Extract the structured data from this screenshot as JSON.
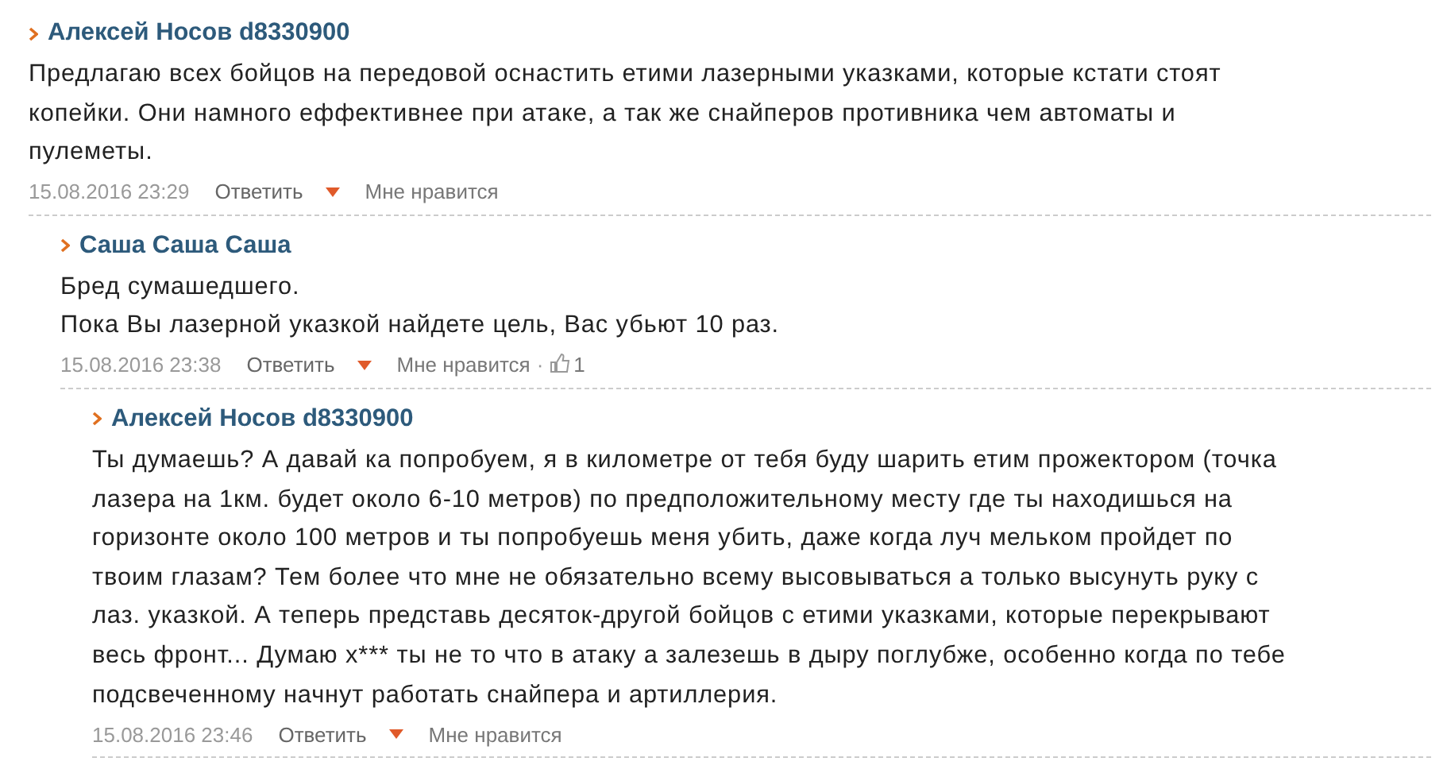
{
  "comments": [
    {
      "author": "Алексей Носов d8330900",
      "text": "Предлагаю всех бойцов на передовой оснастить етими лазерными указками, которые кстати стоят\nкопейки. Они намного еффективнее при атаке, а так же снайперов противника чем автоматы и\nпулеметы.",
      "date": "15.08.2016 23:29",
      "reply": "Ответить",
      "like": "Мне нравится",
      "children": [
        {
          "author": "Саша Саша Саша",
          "text": "Бред сумашедшего.\nПока Вы лазерной указкой найдете цель, Вас убьют 10 раз.",
          "date": "15.08.2016 23:38",
          "reply": "Ответить",
          "like": "Мне нравится",
          "likes_separator": "·",
          "likes": "1",
          "children": [
            {
              "author": "Алексей Носов d8330900",
              "text": "Ты думаешь? А давай ка попробуем, я в километре от тебя буду шарить етим прожектором (точка\nлазера на 1км. будет около 6-10 метров) по предположительному месту где ты находишься на\nгоризонте около 100 метров и ты попробуешь меня убить, даже когда луч мельком пройдет по\nтвоим глазам? Тем более что мне не обязательно всему высовываться а только высунуть руку с\nлаз. указкой. А теперь представь десяток-другой бойцов с етими указками, которые перекрывают\nвесь фронт... Думаю х*** ты не то что в атаку а залезешь в дыру поглубже, особенно когда по тебе\nподсвеченному начнут работать снайпера и артиллерия.",
              "date": "15.08.2016 23:46",
              "reply": "Ответить",
              "like": "Мне нравится"
            }
          ]
        }
      ]
    }
  ]
}
